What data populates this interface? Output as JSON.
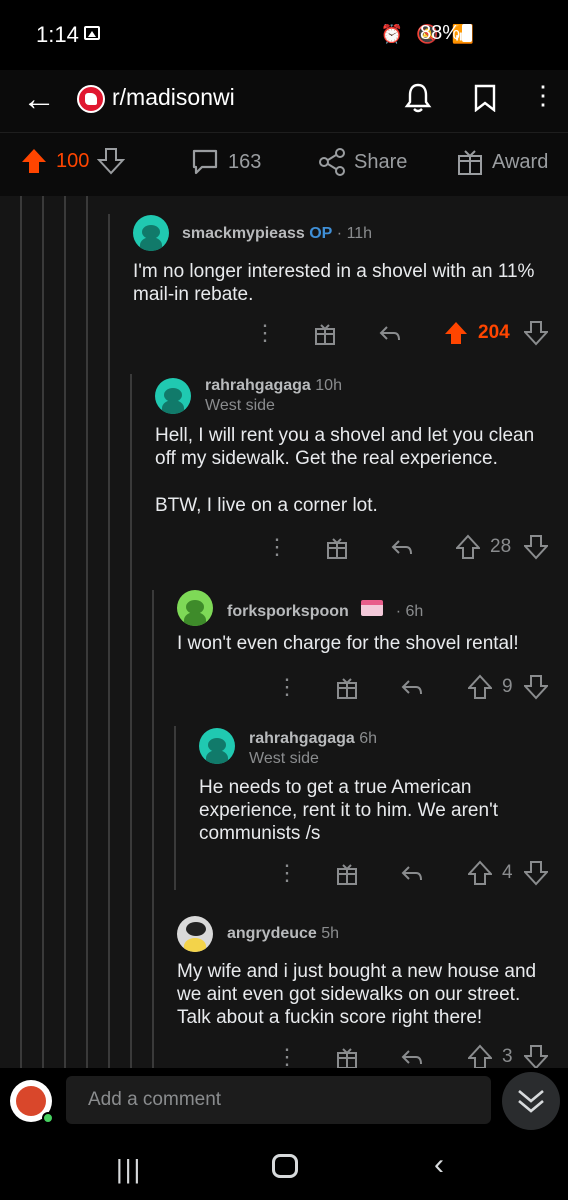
{
  "status_bar": {
    "time": "1:14",
    "status_icons": "⏰ 🔕 📶",
    "battery": "88%"
  },
  "app_bar": {
    "title": "r/madisonwi",
    "back_icon": "arrow-left",
    "notifications_icon": "bell",
    "save_icon": "bookmark",
    "more_icon": "vertical-dots"
  },
  "post_actions": {
    "score": "100",
    "comments": "163",
    "share_label": "Share",
    "award_label": "Award"
  },
  "comments": [
    {
      "username": "smackmypieass",
      "op_label": "OP",
      "time": "· 11h",
      "flair": "",
      "text": "I'm no longer interested in a shovel with an 11% mail-in rebate.",
      "score": "204",
      "upvoted": true
    },
    {
      "username": "rahrahgagaga",
      "time": "10h",
      "flair": "West side",
      "text_p1": "Hell, I will rent you a shovel and let you clean off my sidewalk. Get the real experience.",
      "text_p2": "BTW, I live on a corner lot.",
      "score": "28"
    },
    {
      "username": "forksporkspoon",
      "time": "· 6h",
      "text": "I won't even charge for the shovel rental!",
      "score": "9"
    },
    {
      "username": "rahrahgagaga",
      "time": "6h",
      "flair": "West side",
      "text": "He needs to get a true American experience, rent it to him. We aren't communists /s",
      "score": "4"
    },
    {
      "username": "angrydeuce",
      "time": "5h",
      "text": "My wife and i just bought a new house and we aint even got sidewalks on our street. Talk about a fuckin score right there!",
      "score": "3"
    }
  ],
  "composer": {
    "placeholder": "Add a comment"
  },
  "colors": {
    "accent_upvote": "#ff4500",
    "background": "#151515",
    "op_blue": "#3f8fd6"
  }
}
